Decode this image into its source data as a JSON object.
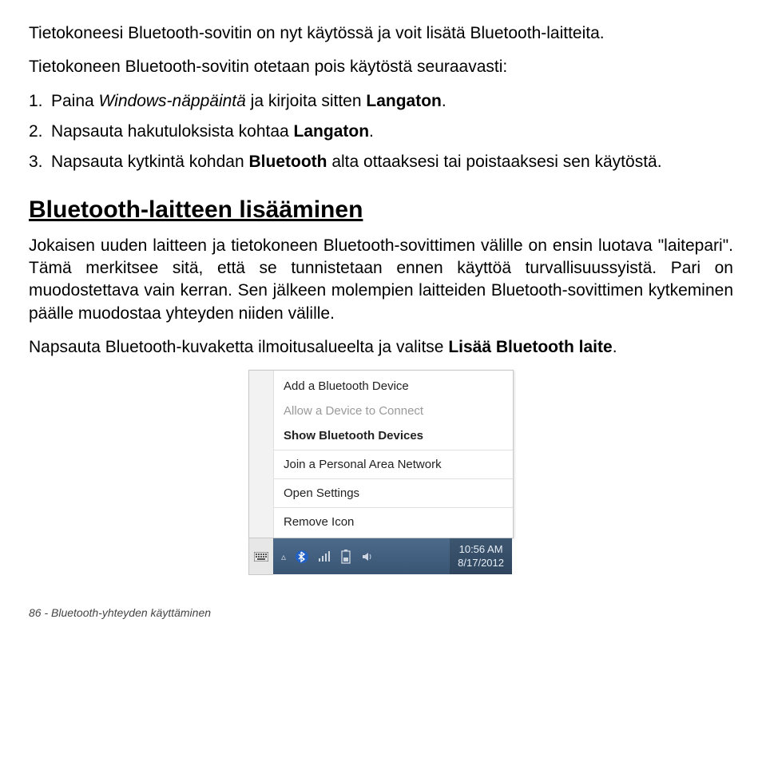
{
  "intro": {
    "p1": "Tietokoneesi Bluetooth-sovitin on nyt käytössä ja voit lisätä Bluetooth-laitteita.",
    "p2": "Tietokoneen Bluetooth-sovitin otetaan pois käytöstä seuraavasti:"
  },
  "list": {
    "n1": "1.",
    "i1a": "Paina ",
    "i1b": "Windows-näppäintä",
    "i1c": " ja kirjoita sitten ",
    "i1d": "Langaton",
    "i1e": ".",
    "n2": "2.",
    "i2a": "Napsauta hakutuloksista kohtaa ",
    "i2b": "Langaton",
    "i2c": ".",
    "n3": "3.",
    "i3a": "Napsauta kytkintä kohdan ",
    "i3b": "Bluetooth",
    "i3c": "  alta ottaaksesi tai poistaaksesi sen käytöstä."
  },
  "heading": "Bluetooth-laitteen lisääminen",
  "para3": "Jokaisen uuden laitteen ja tietokoneen Bluetooth-sovittimen välille on ensin luotava \"laitepari\". Tämä merkitsee sitä, että se tunnistetaan ennen käyttöä turvallisuussyistä. Pari on muodostettava vain kerran. Sen jälkeen molempien laitteiden Bluetooth-sovittimen kytkeminen päälle muodostaa yhteyden niiden välille.",
  "para4a": "Napsauta Bluetooth-kuvaketta ilmoitusalueelta ja valitse ",
  "para4b": "Lisää Bluetooth laite",
  "para4c": ".",
  "menu": {
    "add": "Add a Bluetooth Device",
    "allow": "Allow a Device to Connect",
    "show": "Show Bluetooth Devices",
    "join": "Join a Personal Area Network",
    "open": "Open Settings",
    "remove": "Remove Icon"
  },
  "taskbar": {
    "time": "10:56 AM",
    "date": "8/17/2012"
  },
  "footer": "86 - Bluetooth-yhteyden käyttäminen"
}
